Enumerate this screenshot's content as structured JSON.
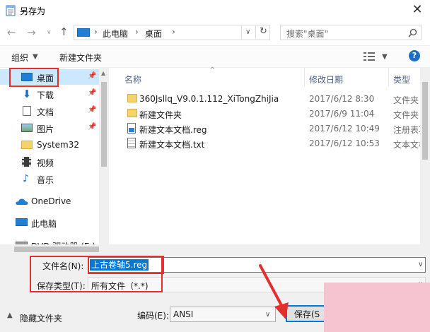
{
  "window": {
    "title": "另存为",
    "close_glyph": "✕"
  },
  "addressbar": {
    "breadcrumb": [
      "此电脑",
      "桌面"
    ],
    "search_placeholder": "搜索\"桌面\""
  },
  "toolbar": {
    "organize_label": "组织",
    "new_folder_label": "新建文件夹"
  },
  "sidebar": {
    "items": [
      {
        "label": "桌面",
        "icon": "desktop-icon",
        "pinned": true,
        "selected": true
      },
      {
        "label": "下载",
        "icon": "download-icon",
        "pinned": true
      },
      {
        "label": "文档",
        "icon": "document-icon",
        "pinned": true
      },
      {
        "label": "图片",
        "icon": "pictures-icon",
        "pinned": true
      },
      {
        "label": "System32",
        "icon": "folder-icon",
        "pinned": false
      },
      {
        "label": "视频",
        "icon": "video-icon",
        "pinned": false
      },
      {
        "label": "音乐",
        "icon": "music-icon",
        "pinned": false
      },
      {
        "label": "OneDrive",
        "icon": "onedrive-icon",
        "pinned": false
      },
      {
        "label": "此电脑",
        "icon": "computer-icon",
        "pinned": false
      },
      {
        "label": "DVD 驱动器 (E:) C",
        "icon": "dvd-icon",
        "pinned": false
      }
    ]
  },
  "filelist": {
    "headers": {
      "name": "名称",
      "date": "修改日期",
      "type": "类型"
    },
    "rows": [
      {
        "name": "360Jsllq_V9.0.1.112_XiTongZhiJia",
        "date": "2017/6/12 8:30",
        "type": "文件夹",
        "icon": "folder-icon"
      },
      {
        "name": "新建文件夹",
        "date": "2017/6/9 11:04",
        "type": "文件夹",
        "icon": "folder-icon"
      },
      {
        "name": "新建文本文档.reg",
        "date": "2017/6/12 10:49",
        "type": "注册表项",
        "icon": "registry-file-icon"
      },
      {
        "name": "新建文本文档.txt",
        "date": "2017/6/12 10:53",
        "type": "文本文档",
        "icon": "text-file-icon"
      }
    ]
  },
  "form": {
    "filename_label": "文件名(N):",
    "filename_value": "上古卷轴5.reg",
    "filetype_label": "保存类型(T):",
    "filetype_value": "所有文件（*.*)",
    "encoding_label": "编码(E):",
    "encoding_value": "ANSI",
    "hide_folders_label": "隐藏文件夹",
    "save_label": "保存(S"
  },
  "colors": {
    "accent": "#0078d7",
    "highlight_red": "#e3302f",
    "selection_bg": "#cce8ff",
    "folder_yellow": "#f5d36b",
    "watermark_pink": "#f5c4d0"
  }
}
